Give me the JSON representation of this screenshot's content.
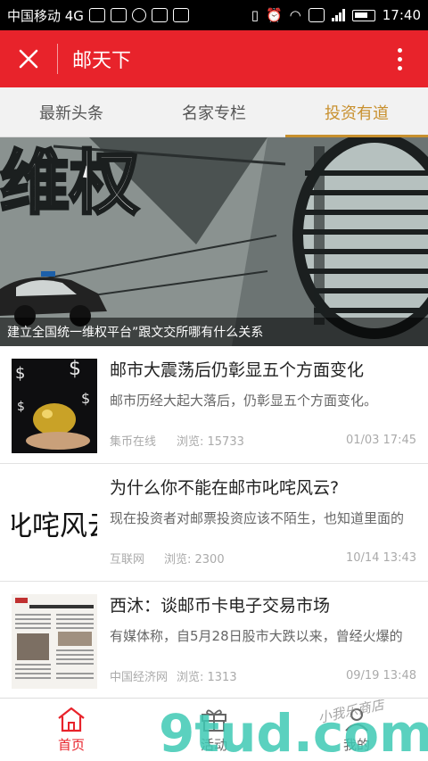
{
  "status_bar": {
    "carrier": "中国移动 4G",
    "network": "4G",
    "time": "17:40"
  },
  "header": {
    "title": "邮天下",
    "close_icon": "close-icon",
    "more_icon": "more-vertical-icon",
    "bg_color": "#e8232b"
  },
  "tabs": [
    {
      "label": "最新头条",
      "active": false
    },
    {
      "label": "名家专栏",
      "active": false
    },
    {
      "label": "投资有道",
      "active": true
    }
  ],
  "banner": {
    "overlay_text": "维权",
    "caption": "建立全国统一维权平台”跟文交所哪有什么关系"
  },
  "news": [
    {
      "title": "邮市大震荡后仍彰显五个方面变化",
      "summary": "邮市历经大起大落后，仍彰显五个方面变化。",
      "source": "集币在线",
      "views": "浏览: 15733",
      "time": "01/03 17:45"
    },
    {
      "title": "为什么你不能在邮市叱咤风云?",
      "summary": "现在投资者对邮票投资应该不陌生，也知道里面的",
      "source": "互联网",
      "views": "浏览: 2300",
      "time": "10/14 13:43",
      "thumb_text": "叱咤风云"
    },
    {
      "title": "西沐：谈邮币卡电子交易市场",
      "summary": "有媒体称，自5月28日股市大跌以来，曾经火爆的",
      "source": "中国经济网",
      "views": "浏览: 1313",
      "time": "09/19 13:48"
    }
  ],
  "bottom_nav": [
    {
      "label": "首页",
      "icon": "home-icon",
      "active": true
    },
    {
      "label": "活动",
      "icon": "gift-icon",
      "active": false
    },
    {
      "label": "我的",
      "icon": "user-icon",
      "active": false
    }
  ],
  "watermark": {
    "logo": "9tud.com",
    "handwriting": "小我乐商店"
  },
  "colors": {
    "accent": "#e8232b",
    "tab_active": "#c8902e"
  }
}
